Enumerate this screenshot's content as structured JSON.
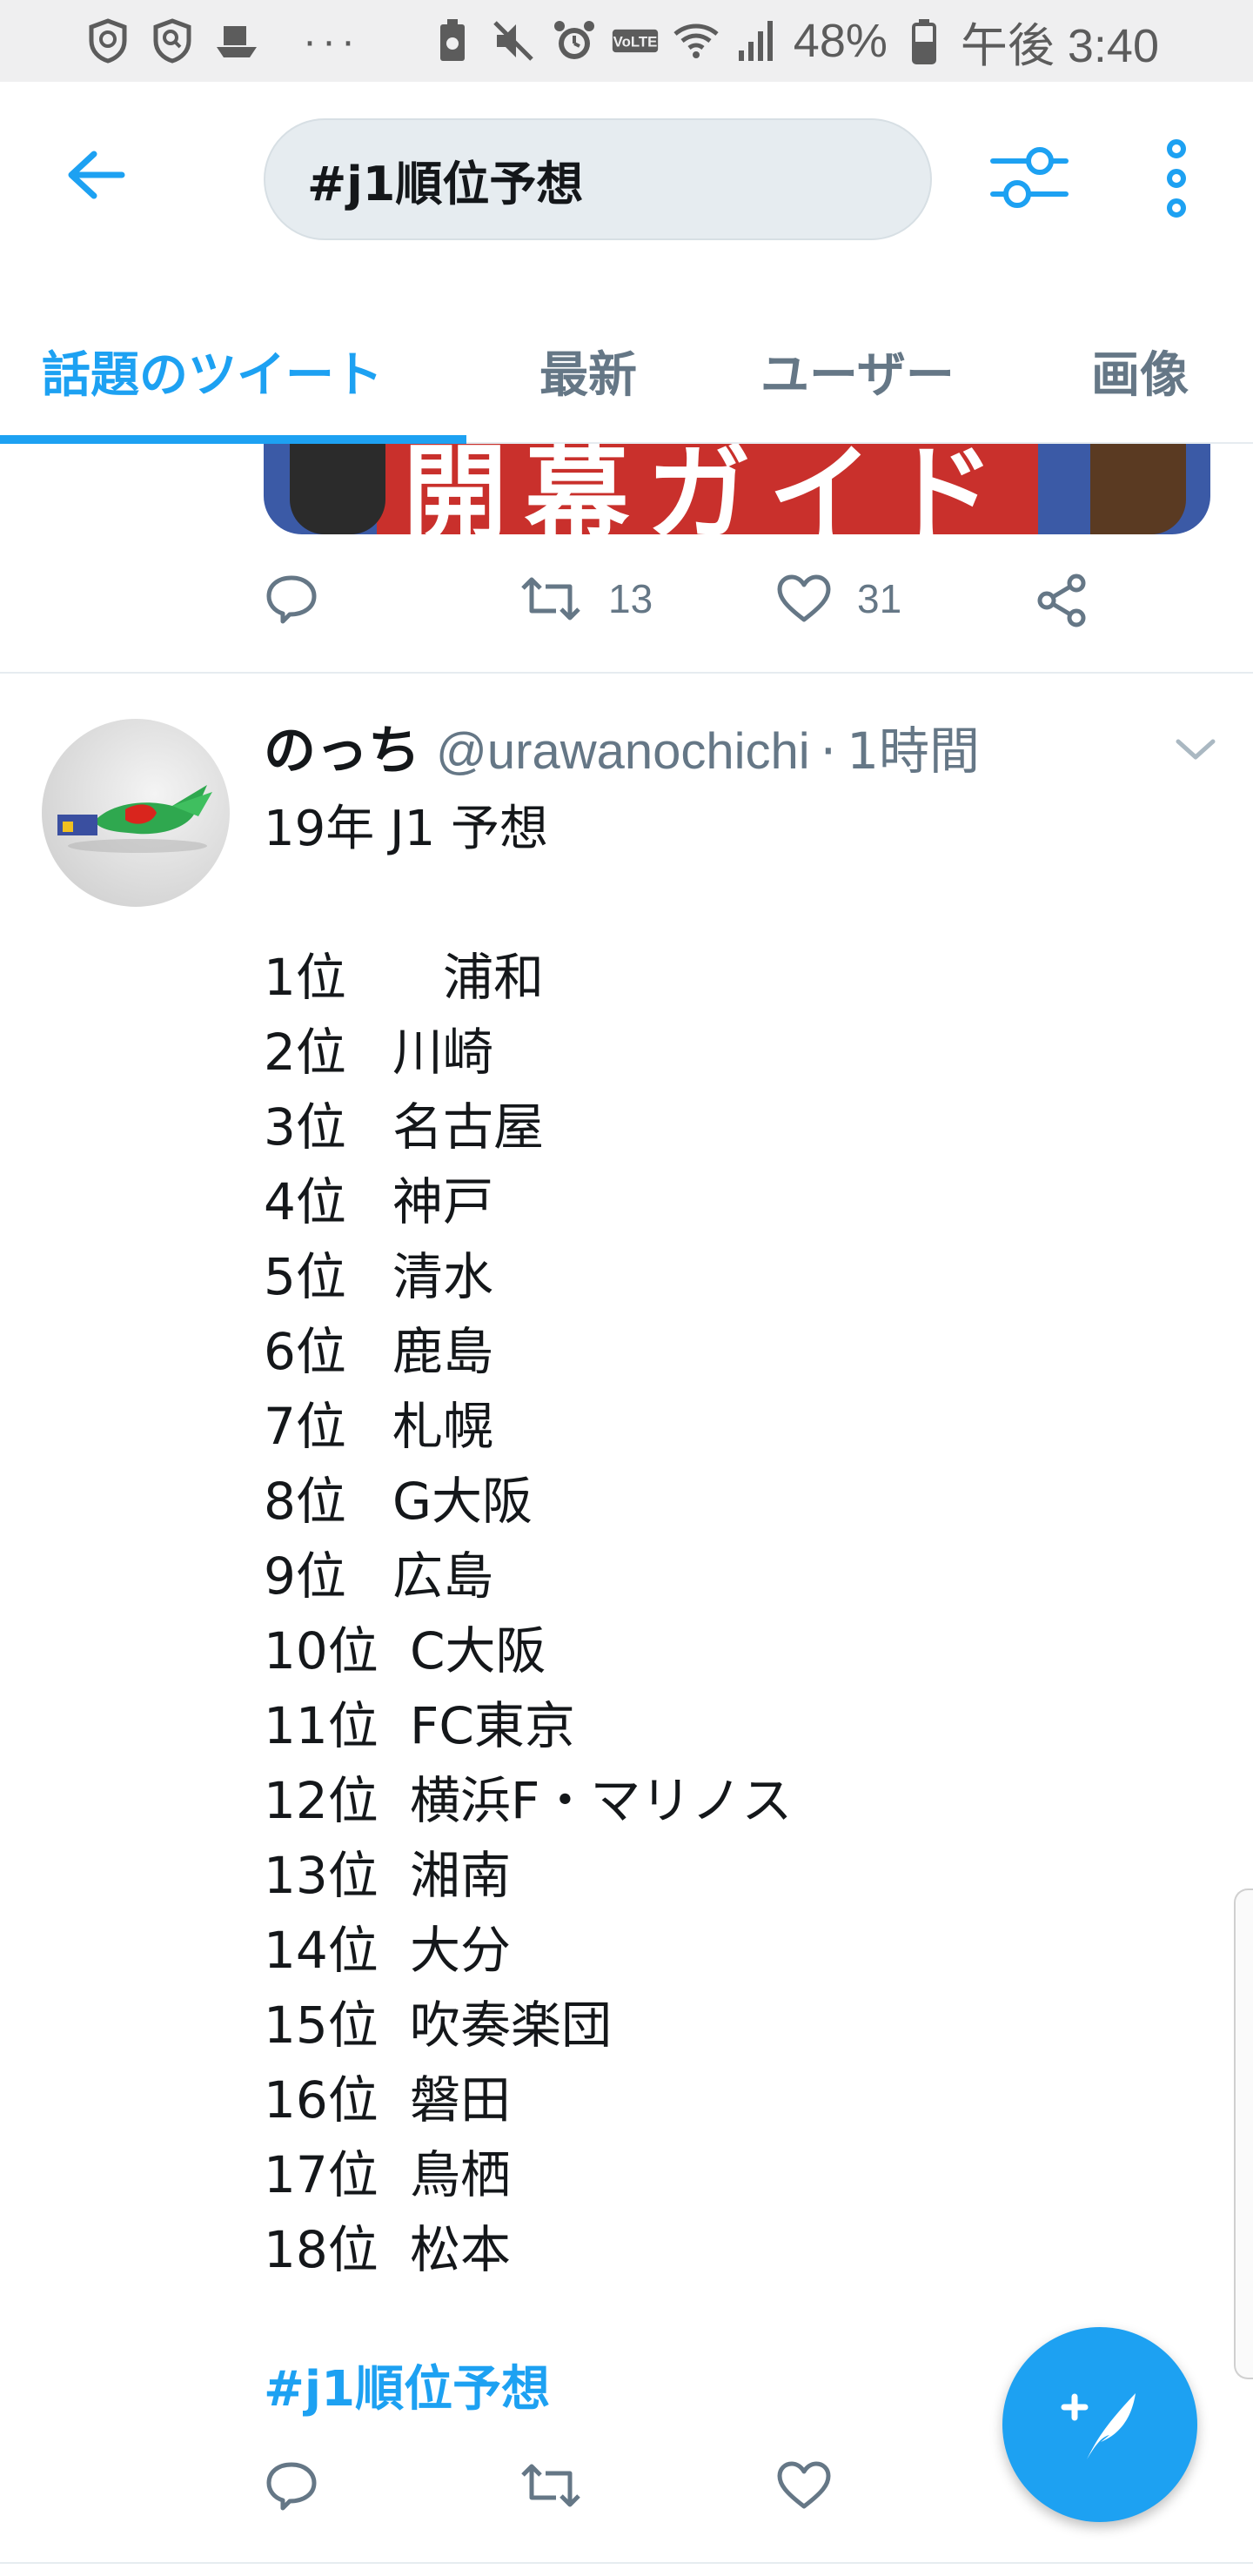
{
  "status_bar": {
    "icons_left": [
      "shield-icon",
      "shield-search-icon",
      "boat-icon"
    ],
    "more": "···",
    "icons_right": [
      "battery-saver-icon",
      "mute-icon",
      "alarm-icon",
      "volte-icon",
      "wifi-icon",
      "signal-icon"
    ],
    "battery": "48%",
    "time": "午後 3:40"
  },
  "header": {
    "search_value": "#j1順位予想"
  },
  "tabs": [
    {
      "label": "話題のツイート",
      "active": true
    },
    {
      "label": "最新",
      "active": false
    },
    {
      "label": "ユーザー",
      "active": false
    },
    {
      "label": "画像",
      "active": false
    }
  ],
  "tweet1": {
    "media_text": "開幕ガイド",
    "retweets": "13",
    "likes": "31"
  },
  "tweet2": {
    "name": "のっち",
    "handle": "@urawanochichi",
    "dot": "·",
    "time": "1時間",
    "title": "19年 J1 予想",
    "rankings": [
      {
        "no": "1位",
        "team": "　浦和"
      },
      {
        "no": "2位",
        "team": "川崎"
      },
      {
        "no": "3位",
        "team": "名古屋"
      },
      {
        "no": "4位",
        "team": "神戸"
      },
      {
        "no": "5位",
        "team": "清水"
      },
      {
        "no": "6位",
        "team": "鹿島"
      },
      {
        "no": "7位",
        "team": "札幌"
      },
      {
        "no": "8位",
        "team": "G大阪"
      },
      {
        "no": "9位",
        "team": "広島"
      },
      {
        "no": "10位",
        "team": "C大阪"
      },
      {
        "no": "11位",
        "team": "FC東京"
      },
      {
        "no": "12位",
        "team": "横浜F・マリノス"
      },
      {
        "no": "13位",
        "team": "湘南"
      },
      {
        "no": "14位",
        "team": "大分"
      },
      {
        "no": "15位",
        "team": "吹奏楽団"
      },
      {
        "no": "16位",
        "team": "磐田"
      },
      {
        "no": "17位",
        "team": "鳥栖"
      },
      {
        "no": "18位",
        "team": "松本"
      }
    ],
    "hashtag": "#j1順位予想"
  },
  "colors": {
    "accent": "#1da1f2",
    "secondary_text": "#657786",
    "primary_text": "#14171a",
    "status_bar_bg": "#efeff0"
  }
}
